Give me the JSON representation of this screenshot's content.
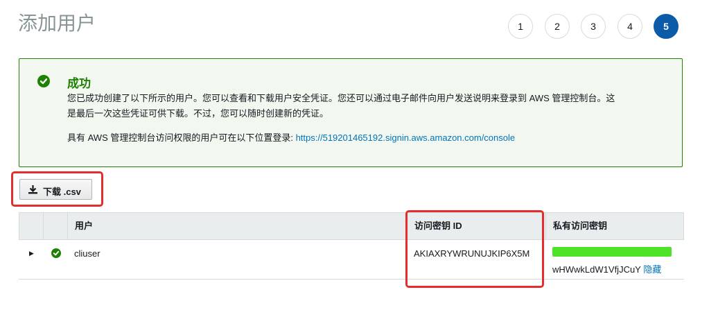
{
  "page": {
    "title": "添加用户"
  },
  "steps": {
    "items": [
      "1",
      "2",
      "3",
      "4",
      "5"
    ],
    "active": "5"
  },
  "alert": {
    "title": "成功",
    "line1": "您已成功创建了以下所示的用户。您可以查看和下载用户安全凭证。您还可以通过电子邮件向用户发送说明来登录到 AWS 管理控制台。这",
    "line2": "是最后一次这些凭证可供下载。不过，您可以随时创建新的凭证。",
    "login_prefix": "具有 AWS 管理控制台访问权限的用户可在以下位置登录: ",
    "console_url": "https://519201465192.signin.aws.amazon.com/console",
    "icon": "check-circle-icon",
    "color": "#1d8102"
  },
  "download": {
    "label": "下载 .csv",
    "icon": "download-icon"
  },
  "table": {
    "headers": {
      "user": "用户",
      "access_key_id": "访问密钥 ID",
      "secret_key": "私有访问密钥"
    },
    "rows": [
      {
        "user": "cliuser",
        "status_icon": "check-circle-icon",
        "access_key_id": "AKIAXRYWRUNUJKIP6X5M",
        "secret_visible": "wHWwkLdW1VfjJCuY",
        "hide_label": "隐藏"
      }
    ]
  },
  "colors": {
    "accent": "#0c5ba8",
    "success": "#1d8102",
    "link": "#0073bb",
    "highlight": "#e52d2d",
    "mask": "#4fe327"
  }
}
